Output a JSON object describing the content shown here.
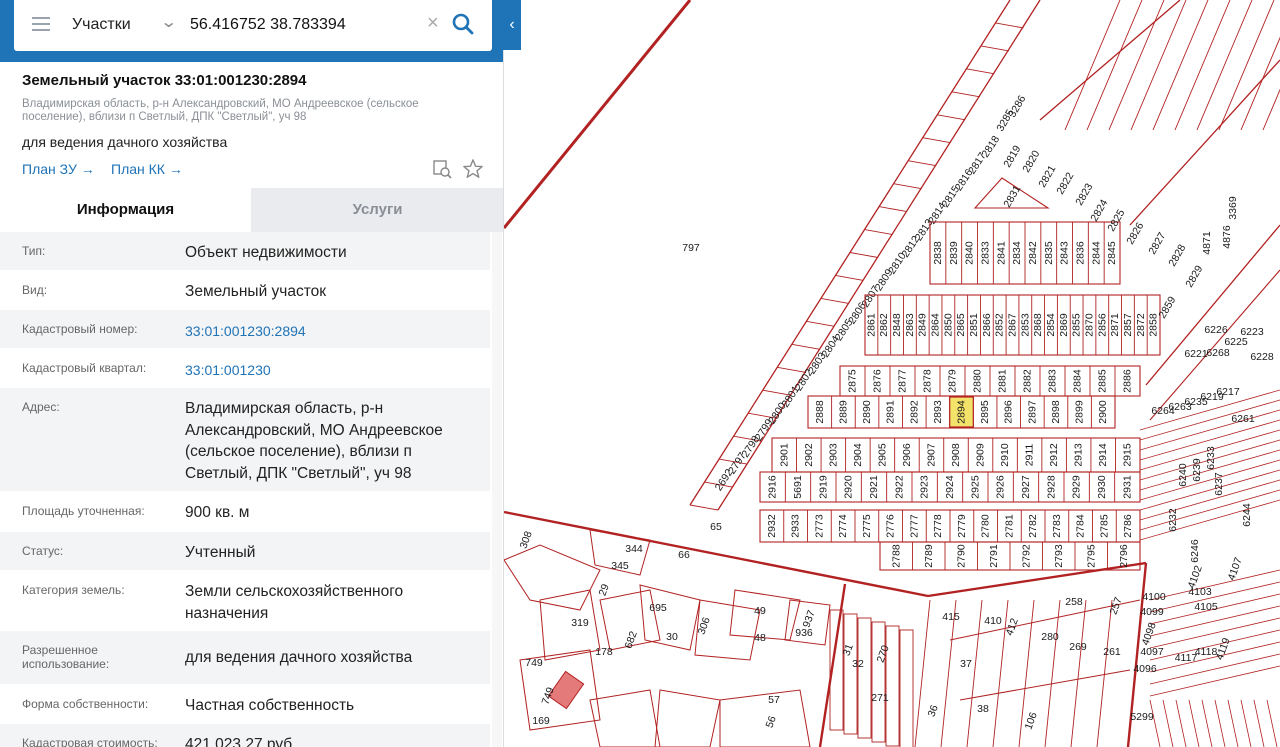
{
  "search": {
    "layer": "Участки",
    "query": "56.416752 38.783394"
  },
  "parcel": {
    "title": "Земельный участок 33:01:001230:2894",
    "address_short": "Владимирская область, р-н Александровский, МО Андреевское (сельское поселение), вблизи п Светлый, ДПК \"Светлый\", уч 98",
    "purpose": "для ведения дачного хозяйства",
    "plan_zu": "План ЗУ →",
    "plan_kk": "План КК →"
  },
  "tabs": {
    "info": "Информация",
    "services": "Услуги"
  },
  "info_rows": [
    {
      "label": "Тип:",
      "value": "Объект недвижимости"
    },
    {
      "label": "Вид:",
      "value": "Земельный участок"
    },
    {
      "label": "Кадастровый номер:",
      "value": "33:01:001230:2894"
    },
    {
      "label": "Кадастровый квартал:",
      "value": "33:01:001230"
    },
    {
      "label": "Адрес:",
      "value": "Владимирская область, р-н Александровский, МО Андреевское (сельское поселение), вблизи п Светлый, ДПК \"Светлый\", уч 98"
    },
    {
      "label": "Площадь уточненная:",
      "value": "900 кв. м"
    },
    {
      "label": "Статус:",
      "value": "Учтенный"
    },
    {
      "label": "Категория земель:",
      "value": "Земли сельскохозяйственного назначения"
    },
    {
      "label": "Разрешенное использование:",
      "value": "для ведения дачного хозяйства"
    },
    {
      "label": "Форма собственности:",
      "value": "Частная собственность"
    },
    {
      "label": "Кадастровая стоимость:",
      "value": "421 023,27 руб."
    }
  ],
  "map": {
    "line_color": "#b22222",
    "highlight_color": "#f3e36a",
    "selected_label": "2894",
    "block_rows": [
      [
        "2838",
        "2839",
        "2840",
        "2833",
        "2841",
        "2834",
        "2842",
        "2835",
        "2843",
        "2836",
        "2844",
        "2845"
      ],
      [
        "2861",
        "2862",
        "2848",
        "2863",
        "2849",
        "2864",
        "2850",
        "2865",
        "2851",
        "2866",
        "2852",
        "2867",
        "2853",
        "2868",
        "2854",
        "2869",
        "2855",
        "2870",
        "2856",
        "2871",
        "2857",
        "2872",
        "2858"
      ],
      [
        "2875",
        "2876",
        "2877",
        "2878",
        "2879",
        "2880",
        "2881",
        "2882",
        "2883",
        "2884",
        "2885",
        "2886"
      ],
      [
        "2888",
        "2889",
        "2890",
        "2891",
        "2892",
        "2893",
        "2894",
        "2895",
        "2896",
        "2897",
        "2898",
        "2899",
        "2900"
      ],
      [
        "2901",
        "2902",
        "2903",
        "2904",
        "2905",
        "2906",
        "2907",
        "2908",
        "2909",
        "2910",
        "2911",
        "2912",
        "2913",
        "2914",
        "2915"
      ],
      [
        "2916",
        "5691",
        "2919",
        "2920",
        "2921",
        "2922",
        "2923",
        "2924",
        "2925",
        "2926",
        "2927",
        "2928",
        "2929",
        "2930",
        "2931"
      ],
      [
        "2932",
        "2933",
        "2773",
        "2774",
        "2775",
        "2776",
        "2777",
        "2778",
        "2779",
        "2780",
        "2781",
        "2782",
        "2783",
        "2784",
        "2785",
        "2786"
      ],
      [
        "2788",
        "2789",
        "2790",
        "2791",
        "2792",
        "2793",
        "2795",
        "2796"
      ]
    ],
    "diagonal_labels": [
      "2818",
      "2817",
      "2816",
      "2815",
      "2814",
      "2813",
      "2812",
      "2810",
      "2809",
      "2807",
      "2806",
      "2805",
      "2804",
      "2803",
      "2802",
      "2801",
      "2800",
      "2799",
      "2798",
      "2797",
      "2692"
    ],
    "top_labels": [
      "2831",
      "2819",
      "2820",
      "2821",
      "2822",
      "2823",
      "2824",
      "2825",
      "2826",
      "2827",
      "2828",
      "2829",
      "2859",
      "3286",
      "3285"
    ],
    "right_labels": [
      "6226",
      "6221",
      "6268",
      "6225",
      "6223",
      "6228",
      "6264",
      "6263",
      "6235",
      "6219",
      "6217",
      "6261",
      "6240",
      "6239",
      "6233",
      "6237",
      "6232",
      "6246",
      "6244",
      "4876",
      "3369",
      "4871"
    ],
    "bottom_labels": [
      "797",
      "308",
      "344",
      "345",
      "29",
      "319",
      "178",
      "682",
      "695",
      "30",
      "306",
      "49",
      "48",
      "937",
      "936",
      "749",
      "749",
      "169",
      "57",
      "56",
      "65",
      "66",
      "31",
      "32",
      "271",
      "270",
      "415",
      "410",
      "412",
      "280",
      "258",
      "257",
      "269",
      "261",
      "36",
      "37",
      "38",
      "106",
      "4100",
      "4099",
      "4098",
      "4097",
      "4096",
      "4102",
      "4103",
      "4105",
      "4107",
      "4117",
      "4118",
      "4119",
      "5299"
    ]
  }
}
